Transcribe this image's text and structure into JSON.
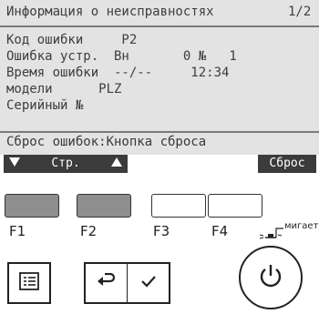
{
  "screen": {
    "title": "Информация о неисправностях",
    "page": "1/2",
    "rows": [
      "Код ошибки     P2",
      "Ошибка устр.  Вн       0 №   1",
      "Время ошибки  --/--     12:34",
      "модели      PLZ",
      "Серийный №"
    ],
    "hint": "Сброс ошибок:Кнопка сброса"
  },
  "softkeys": {
    "page_label": "Стр.",
    "reset_label": "Сброс"
  },
  "function_keys": {
    "f1": "F1",
    "f2": "F2",
    "f3": "F3",
    "f4": "F4",
    "f1_color": "#8e8e8e",
    "f2_color": "#8e8e8e"
  },
  "indicator": {
    "label": "мигает"
  },
  "icons": {
    "menu": "menu-icon",
    "back": "return-icon",
    "ok": "check-icon",
    "power": "power-icon",
    "led": "led-blinking-icon"
  }
}
